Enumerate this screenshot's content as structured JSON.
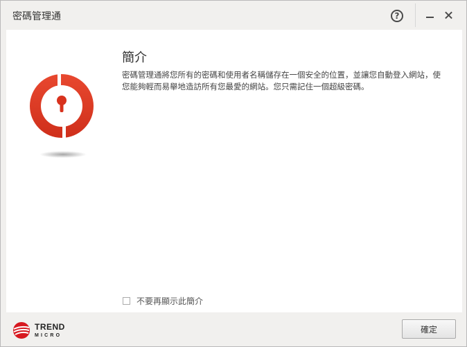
{
  "window": {
    "title": "密碼管理通"
  },
  "titlebar": {
    "help_glyph": "?"
  },
  "intro": {
    "heading": "簡介",
    "description": "密碼管理通將您所有的密碼和使用者名稱儲存在一個安全的位置，並讓您自動登入網站，使您能夠輕而易舉地造訪所有您最愛的網站。您只需記住一個超級密碼。",
    "dont_show_label": "不要再顯示此簡介",
    "dont_show_checked": false
  },
  "footer": {
    "brand_line1": "TREND",
    "brand_line2": "MICRO",
    "ok_label": "確定"
  },
  "colors": {
    "brand_red": "#e33a24",
    "brand_red_dark": "#c92a17"
  }
}
